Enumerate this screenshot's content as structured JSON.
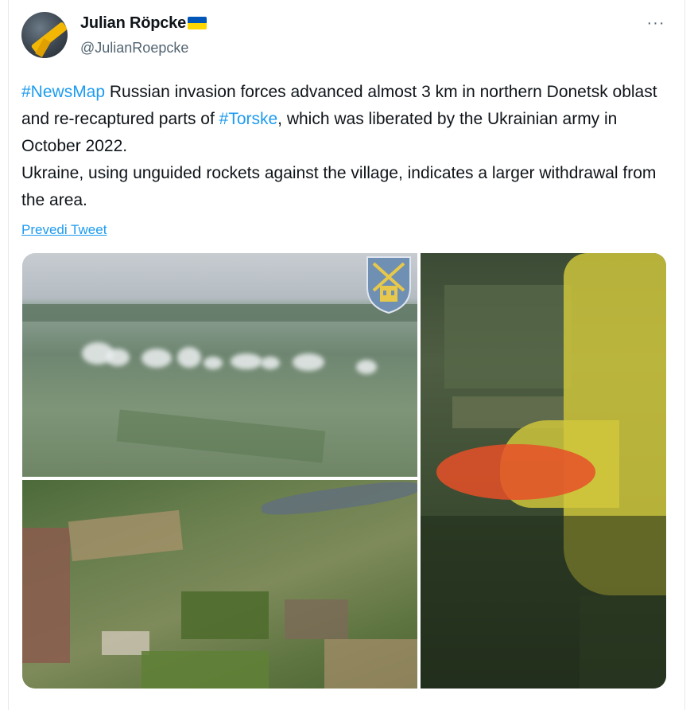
{
  "author": {
    "display_name": "Julian Röpcke",
    "handle": "@JulianRoepcke",
    "verified_flag": "ukraine-flag"
  },
  "menu": {
    "more_label": "···"
  },
  "tweet": {
    "hashtag1": "#NewsMap",
    "text1": " Russian invasion forces advanced almost 3 km in northern Donetsk oblast and re-recaptured parts of ",
    "hashtag2": "#Torske",
    "text2": ", which was liberated by the Ukrainian army in October 2022.",
    "text3": "Ukraine, using unguided rockets against the village, indicates a larger withdrawal from the area."
  },
  "translate_link": "Prevedi Tweet",
  "colors": {
    "link": "#1d9bf0",
    "text": "#0f1419",
    "secondary": "#536471"
  }
}
